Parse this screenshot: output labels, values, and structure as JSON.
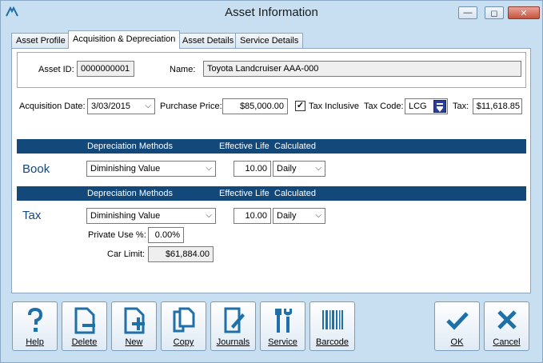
{
  "window": {
    "title": "Asset Information",
    "minimize_glyph": "—",
    "restore_glyph": "◻",
    "close_glyph": "✕"
  },
  "tabs": [
    {
      "label": "Asset Profile",
      "active": false
    },
    {
      "label": "Acquisition & Depreciation",
      "active": true
    },
    {
      "label": "Asset Details",
      "active": false
    },
    {
      "label": "Service Details",
      "active": false
    }
  ],
  "asset": {
    "id_label": "Asset ID:",
    "id_value": "0000000001",
    "name_label": "Name:",
    "name_value": "Toyota Landcruiser AAA-000"
  },
  "acquisition": {
    "date_label": "Acquisition Date:",
    "date_value": "3/03/2015",
    "price_label": "Purchase Price:",
    "price_value": "$85,000.00",
    "tax_inclusive_label": "Tax Inclusive",
    "tax_inclusive_checked": true,
    "tax_code_label": "Tax Code:",
    "tax_code_value": "LCG",
    "tax_label": "Tax:",
    "tax_value": "$11,618.85"
  },
  "headers": {
    "method": "Depreciation Methods",
    "life": "Effective Life",
    "calc": "Calculated"
  },
  "book": {
    "title": "Book",
    "method": "Diminishing Value",
    "life": "10.00",
    "calc": "Daily"
  },
  "tax": {
    "title": "Tax",
    "method": "Diminishing Value",
    "life": "10.00",
    "calc": "Daily",
    "private_use_label": "Private Use %:",
    "private_use_value": "0.00%",
    "car_limit_label": "Car Limit:",
    "car_limit_value": "$61,884.00"
  },
  "buttons": {
    "help": "Help",
    "delete": "Delete",
    "new": "New",
    "copy": "Copy",
    "journals": "Journals",
    "service": "Service",
    "barcode": "Barcode",
    "ok": "OK",
    "cancel": "Cancel"
  },
  "colors": {
    "accent": "#13487a",
    "icon": "#1f6fa8",
    "background": "#c8dff2"
  }
}
